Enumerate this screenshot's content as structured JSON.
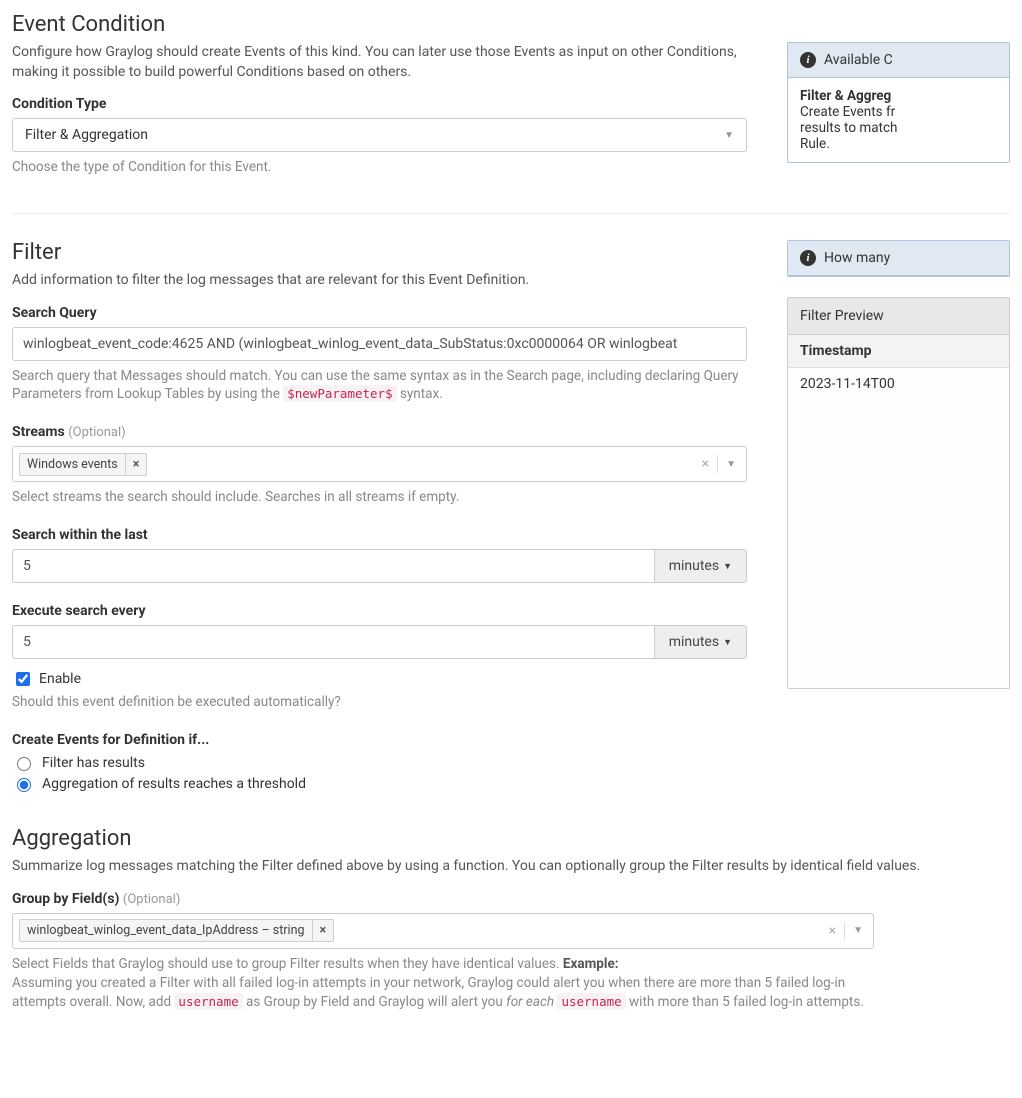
{
  "eventCondition": {
    "heading": "Event Condition",
    "desc": "Configure how Graylog should create Events of this kind. You can later use those Events as input on other Conditions, making it possible to build powerful Conditions based on others.",
    "conditionTypeLabel": "Condition Type",
    "conditionTypeValue": "Filter & Aggregation",
    "conditionTypeHelp": "Choose the type of Condition for this Event."
  },
  "sidePanel1": {
    "title": "Available C",
    "bodyTitle": "Filter & Aggreg",
    "bodyLine1": "Create Events fr",
    "bodyLine2": "results to match",
    "bodyLine3": "Rule."
  },
  "filter": {
    "heading": "Filter",
    "desc": "Add information to filter the log messages that are relevant for this Event Definition.",
    "searchQueryLabel": "Search Query",
    "searchQueryValue": "winlogbeat_event_code:4625 AND (winlogbeat_winlog_event_data_SubStatus:0xc0000064 OR winlogbeat",
    "searchQueryHelpPre": "Search query that Messages should match. You can use the same syntax as in the Search page, including declaring Query Parameters from Lookup Tables by using the ",
    "searchQueryHelpCode": "$newParameter$",
    "searchQueryHelpPost": " syntax.",
    "streamsLabel": "Streams",
    "optional": "(Optional)",
    "streamChip": "Windows events",
    "streamsHelp": "Select streams the search should include. Searches in all streams if empty.",
    "searchWithinLabel": "Search within the last",
    "searchWithinValue": "5",
    "searchWithinUnit": "minutes",
    "executeEveryLabel": "Execute search every",
    "executeEveryValue": "5",
    "executeEveryUnit": "minutes",
    "enableLabel": "Enable",
    "enableHelp": "Should this event definition be executed automatically?",
    "createEventsLabel": "Create Events for Definition if...",
    "radio1": "Filter has results",
    "radio2": "Aggregation of results reaches a threshold"
  },
  "sidePanel2": {
    "title": "How many"
  },
  "filterPreview": {
    "title": "Filter Preview",
    "th": "Timestamp",
    "td": "2023-11-14T00"
  },
  "aggregation": {
    "heading": "Aggregation",
    "desc": "Summarize log messages matching the Filter defined above by using a function. You can optionally group the Filter results by identical field values.",
    "groupByLabel": "Group by Field(s)",
    "optional": "(Optional)",
    "groupChip": "winlogbeat_winlog_event_data_IpAddress – string",
    "help1": "Select Fields that Graylog should use to group Filter results when they have identical values. ",
    "exampleLabel": "Example:",
    "help2a": "Assuming you created a Filter with all failed log-in attempts in your network, Graylog could alert you when there are more than 5 failed log-in attempts overall. Now, add ",
    "code1": "username",
    "help2b": " as Group by Field and Graylog will alert you ",
    "help2c": "for each",
    "code2": "username",
    "help2d": " with more than 5 failed log-in attempts."
  }
}
